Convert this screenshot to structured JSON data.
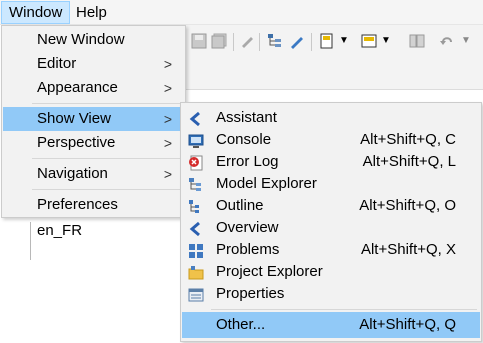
{
  "menubar": {
    "items": [
      {
        "label": "Window"
      },
      {
        "label": "Help"
      }
    ]
  },
  "background": {
    "editor_text": "en_FR"
  },
  "window_menu": {
    "items": [
      {
        "label": "New Window",
        "submenu": false
      },
      {
        "label": "Editor",
        "submenu": true
      },
      {
        "label": "Appearance",
        "submenu": true
      },
      {
        "label": "Show View",
        "submenu": true,
        "highlighted": true
      },
      {
        "label": "Perspective",
        "submenu": true
      },
      {
        "label": "Navigation",
        "submenu": true
      },
      {
        "label": "Preferences",
        "submenu": false
      }
    ],
    "arrow": ">"
  },
  "show_view_menu": {
    "items": [
      {
        "label": "Assistant",
        "shortcut": "",
        "icon": "assistant-icon"
      },
      {
        "label": "Console",
        "shortcut": "Alt+Shift+Q, C",
        "icon": "console-icon"
      },
      {
        "label": "Error Log",
        "shortcut": "Alt+Shift+Q, L",
        "icon": "error-log-icon"
      },
      {
        "label": "Model Explorer",
        "shortcut": "",
        "icon": "model-explorer-icon"
      },
      {
        "label": "Outline",
        "shortcut": "Alt+Shift+Q, O",
        "icon": "outline-icon"
      },
      {
        "label": "Overview",
        "shortcut": "",
        "icon": "overview-icon"
      },
      {
        "label": "Problems",
        "shortcut": "Alt+Shift+Q, X",
        "icon": "problems-icon"
      },
      {
        "label": "Project Explorer",
        "shortcut": "",
        "icon": "project-explorer-icon"
      },
      {
        "label": "Properties",
        "shortcut": "",
        "icon": "properties-icon"
      },
      {
        "label": "Other...",
        "shortcut": "Alt+Shift+Q, Q",
        "icon": "",
        "highlighted": true
      }
    ]
  },
  "colors": {
    "highlight": "#91c9f7",
    "menubar_active": "#cce8ff",
    "menu_bg": "#f2f2f2"
  }
}
